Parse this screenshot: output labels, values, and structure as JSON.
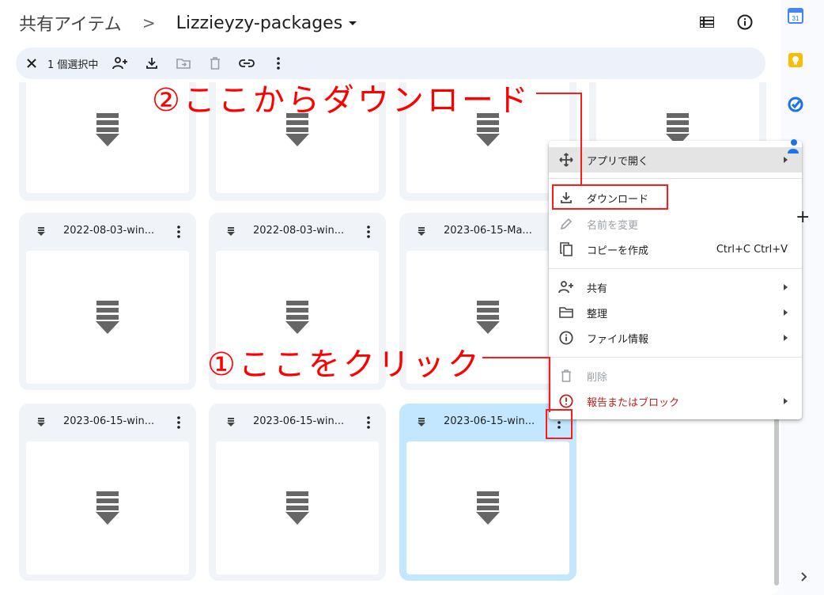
{
  "breadcrumb": {
    "root": "共有アイテム",
    "separator": ">",
    "current": "Lizzieyzy-packages"
  },
  "header_icons": [
    "list-view-icon",
    "info-icon"
  ],
  "selection_bar": {
    "count_label": "1 個選択中",
    "tools": [
      "close-icon",
      "share-icon",
      "download-icon",
      "move-icon",
      "trash-icon",
      "link-icon",
      "more-vert-icon"
    ]
  },
  "files": [
    {
      "name": ""
    },
    {
      "name": ""
    },
    {
      "name": ""
    },
    {
      "name": ""
    },
    {
      "name": "2022-08-03-win..."
    },
    {
      "name": "2022-08-03-win..."
    },
    {
      "name": "2023-06-15-Ma..."
    },
    {
      "name": "2023-06-15-win..."
    },
    {
      "name": "2023-06-15-win..."
    },
    {
      "name": "2023-06-15-win...",
      "selected": true
    }
  ],
  "context_menu": {
    "items": [
      {
        "label": "アプリで開く",
        "icon": "open-with-icon",
        "submenu": true,
        "highlighted": true
      },
      {
        "label": "ダウンロード",
        "icon": "download-icon"
      },
      {
        "label": "名前を変更",
        "icon": "rename-icon",
        "disabled": true
      },
      {
        "label": "コピーを作成",
        "icon": "copy-icon",
        "shortcut": "Ctrl+C Ctrl+V"
      },
      {
        "label": "共有",
        "icon": "share-icon",
        "submenu": true
      },
      {
        "label": "整理",
        "icon": "folder-icon",
        "submenu": true
      },
      {
        "label": "ファイル情報",
        "icon": "info-icon",
        "submenu": true
      },
      {
        "label": "削除",
        "icon": "trash-icon",
        "disabled": true
      },
      {
        "label": "報告またはブロック",
        "icon": "report-icon",
        "submenu": true,
        "danger": true
      }
    ]
  },
  "annotations": {
    "step1": "①ここをクリック",
    "step2": "②ここからダウンロード"
  },
  "colors": {
    "accent_red": "#ff0000",
    "selected_card": "#c2e7ff",
    "card_bg": "#f0f4f9",
    "selection_bar_bg": "#edf2fa",
    "danger_text": "#b3261e"
  },
  "side_panel": {
    "icons": [
      "calendar-icon",
      "keep-icon",
      "tasks-icon",
      "contacts-icon",
      "add-icon",
      "chevron-right-icon"
    ],
    "calendar_day": "31",
    "add_symbol": "+"
  }
}
